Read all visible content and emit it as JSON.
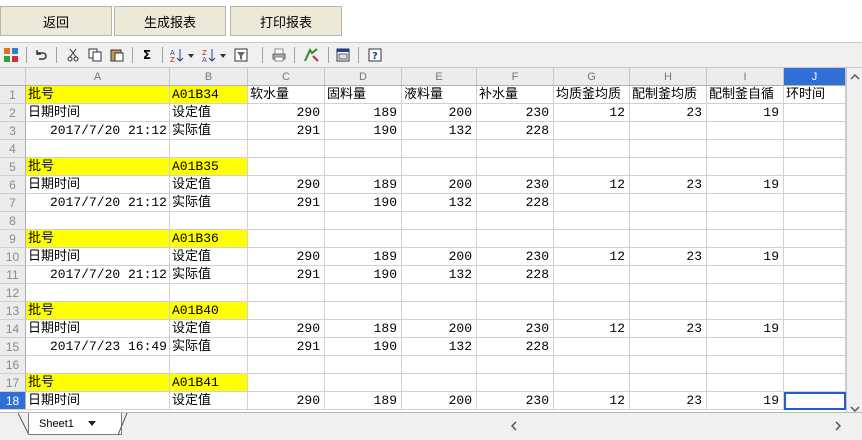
{
  "topbar": {
    "buttons": [
      "返回",
      "生成报表",
      "打印报表"
    ]
  },
  "toolbar": {
    "icons": [
      "app-icon",
      "undo-icon",
      "cut-icon",
      "copy-icon",
      "paste-icon",
      "sum-icon",
      "sort-asc-icon",
      "sort-desc-icon",
      "filter-icon",
      "print-preview-icon",
      "format-icon",
      "chart-icon",
      "help-icon"
    ]
  },
  "columns": [
    "A",
    "B",
    "C",
    "D",
    "E",
    "F",
    "G",
    "H",
    "I",
    "J"
  ],
  "selected_column": "J",
  "rows": [
    {
      "n": "1",
      "cells": [
        "批号",
        "A01B34",
        "软水量",
        "固料量",
        "液料量",
        "补水量",
        "均质釜均质",
        "配制釜均质",
        "配制釜自循",
        "环时间"
      ],
      "batch": true
    },
    {
      "n": "2",
      "cells": [
        "日期时间",
        "设定值",
        "290",
        "189",
        "200",
        "230",
        "12",
        "23",
        "19",
        ""
      ]
    },
    {
      "n": "3",
      "cells": [
        "2017/7/20 21:12",
        "实际值",
        "291",
        "190",
        "132",
        "228",
        "",
        "",
        "",
        ""
      ]
    },
    {
      "n": "4",
      "cells": [
        "",
        "",
        "",
        "",
        "",
        "",
        "",
        "",
        "",
        ""
      ]
    },
    {
      "n": "5",
      "cells": [
        "批号",
        "A01B35",
        "",
        "",
        "",
        "",
        "",
        "",
        "",
        ""
      ],
      "batch": true
    },
    {
      "n": "6",
      "cells": [
        "日期时间",
        "设定值",
        "290",
        "189",
        "200",
        "230",
        "12",
        "23",
        "19",
        ""
      ]
    },
    {
      "n": "7",
      "cells": [
        "2017/7/20 21:12",
        "实际值",
        "291",
        "190",
        "132",
        "228",
        "",
        "",
        "",
        ""
      ]
    },
    {
      "n": "8",
      "cells": [
        "",
        "",
        "",
        "",
        "",
        "",
        "",
        "",
        "",
        ""
      ]
    },
    {
      "n": "9",
      "cells": [
        "批号",
        "A01B36",
        "",
        "",
        "",
        "",
        "",
        "",
        "",
        ""
      ],
      "batch": true
    },
    {
      "n": "10",
      "cells": [
        "日期时间",
        "设定值",
        "290",
        "189",
        "200",
        "230",
        "12",
        "23",
        "19",
        ""
      ]
    },
    {
      "n": "11",
      "cells": [
        "2017/7/20 21:12",
        "实际值",
        "291",
        "190",
        "132",
        "228",
        "",
        "",
        "",
        ""
      ]
    },
    {
      "n": "12",
      "cells": [
        "",
        "",
        "",
        "",
        "",
        "",
        "",
        "",
        "",
        ""
      ]
    },
    {
      "n": "13",
      "cells": [
        "批号",
        "A01B40",
        "",
        "",
        "",
        "",
        "",
        "",
        "",
        ""
      ],
      "batch": true
    },
    {
      "n": "14",
      "cells": [
        "日期时间",
        "设定值",
        "290",
        "189",
        "200",
        "230",
        "12",
        "23",
        "19",
        ""
      ]
    },
    {
      "n": "15",
      "cells": [
        "2017/7/23 16:49",
        "实际值",
        "291",
        "190",
        "132",
        "228",
        "",
        "",
        "",
        ""
      ]
    },
    {
      "n": "16",
      "cells": [
        "",
        "",
        "",
        "",
        "",
        "",
        "",
        "",
        "",
        ""
      ]
    },
    {
      "n": "17",
      "cells": [
        "批号",
        "A01B41",
        "",
        "",
        "",
        "",
        "",
        "",
        "",
        ""
      ],
      "batch": true
    },
    {
      "n": "18",
      "cells": [
        "日期时间",
        "设定值",
        "290",
        "189",
        "200",
        "230",
        "12",
        "23",
        "19",
        ""
      ],
      "selected": true
    }
  ],
  "sheet": {
    "tab_label": "Sheet1"
  },
  "colors": {
    "selection": "#2f6fd6",
    "batch_highlight": "#ffff00"
  }
}
